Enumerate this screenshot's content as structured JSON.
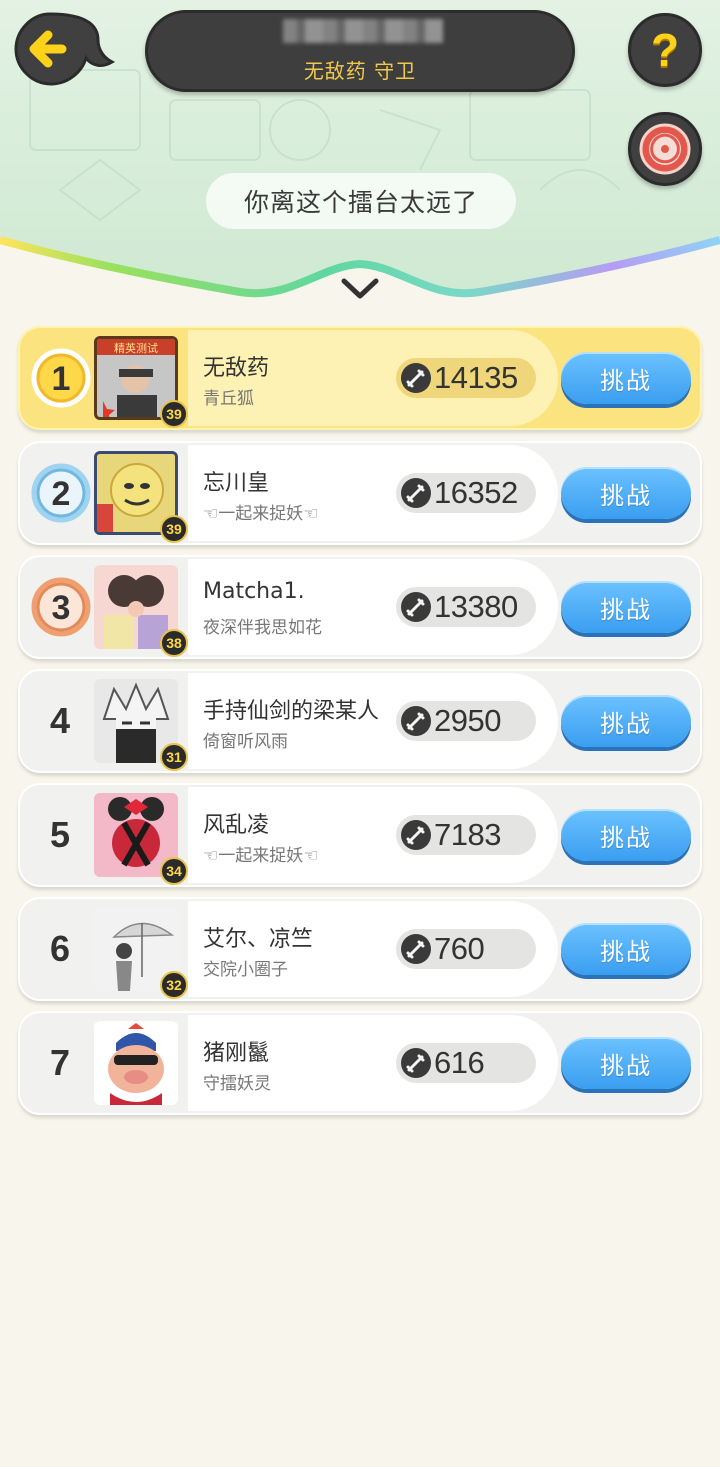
{
  "header": {
    "title": "无敌药 守卫",
    "notice": "你离这个擂台太远了"
  },
  "icons": {
    "back": "back-arrow-icon",
    "help": "question-icon",
    "help_glyph": "?",
    "effect": "swirl-icon",
    "expand": "chevron-down-icon",
    "power": "sword-icon"
  },
  "colors": {
    "first_row": "#fbe47f",
    "button": "#3a9ef0",
    "medal_gold": "#ffd84a",
    "medal_silver": "#9fd3f0",
    "medal_bronze": "#f0a070"
  },
  "ranks": [
    {
      "rank": "1",
      "name": "无敌药",
      "guild": "青丘狐",
      "level": "39",
      "power": "14135",
      "button": "挑战"
    },
    {
      "rank": "2",
      "name": "忘川皇",
      "guild": "☜一起来捉妖☜",
      "level": "39",
      "power": "16352",
      "button": "挑战"
    },
    {
      "rank": "3",
      "name": "Matcha1.",
      "guild": "夜深伴我思如花",
      "level": "38",
      "power": "13380",
      "button": "挑战"
    },
    {
      "rank": "4",
      "name": "手持仙剑的梁某人",
      "guild": "倚窗听风雨",
      "level": "31",
      "power": "2950",
      "button": "挑战"
    },
    {
      "rank": "5",
      "name": "风乱凌",
      "guild": "☜一起来捉妖☜",
      "level": "34",
      "power": "7183",
      "button": "挑战"
    },
    {
      "rank": "6",
      "name": "艾尔、凉竺",
      "guild": "交院小圈子",
      "level": "32",
      "power": "760",
      "button": "挑战"
    },
    {
      "rank": "7",
      "name": "猪刚鬣",
      "guild": "守擂妖灵",
      "level": "",
      "power": "616",
      "button": "挑战"
    }
  ]
}
